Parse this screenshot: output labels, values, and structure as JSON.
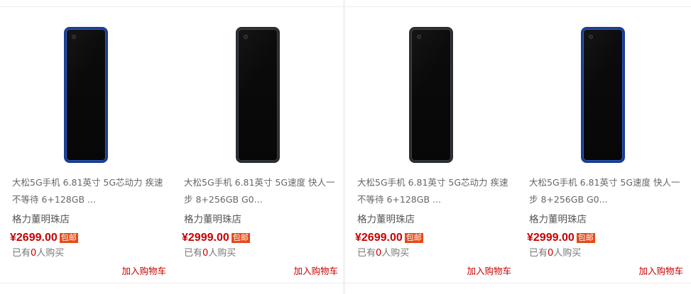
{
  "products": [
    {
      "title": "大松5G手机 6.81英寸 5G芯动力 疾速不等待 6+128GB ...",
      "shop": "格力董明珠店",
      "price": "¥2699.00",
      "badge": "包邮",
      "sold_prefix": "已有",
      "sold_count": "0",
      "sold_suffix": "人购买",
      "cart_label": "加入购物车",
      "phone_color": "blue"
    },
    {
      "title": "大松5G手机 6.81英寸 5G速度 快人一步 8+256GB G0...",
      "shop": "格力董明珠店",
      "price": "¥2999.00",
      "badge": "包邮",
      "sold_prefix": "已有",
      "sold_count": "0",
      "sold_suffix": "人购买",
      "cart_label": "加入购物车",
      "phone_color": "black"
    },
    {
      "title": "大松5G手机 6.81英寸 5G芯动力 疾速不等待 6+128GB ...",
      "shop": "格力董明珠店",
      "price": "¥2699.00",
      "badge": "包邮",
      "sold_prefix": "已有",
      "sold_count": "0",
      "sold_suffix": "人购买",
      "cart_label": "加入购物车",
      "phone_color": "black"
    },
    {
      "title": "大松5G手机 6.81英寸 5G速度 快人一步 8+256GB G0...",
      "shop": "格力董明珠店",
      "price": "¥2999.00",
      "badge": "包邮",
      "sold_prefix": "已有",
      "sold_count": "0",
      "sold_suffix": "人购买",
      "cart_label": "加入购物车",
      "phone_color": "blue"
    }
  ],
  "colors": {
    "price": "#c70000",
    "badge_bg": "#e64a19",
    "text_muted": "#666666"
  }
}
